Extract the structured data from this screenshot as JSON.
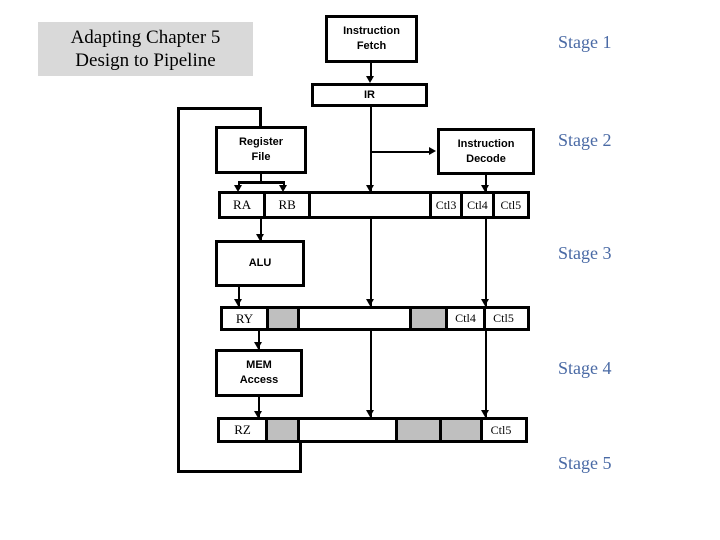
{
  "slide": {
    "title_lines": [
      "Adapting Chapter 5",
      "Design to Pipeline"
    ],
    "background_color": "#ffffff",
    "title_background_color": "#d9d9d9",
    "stage_label_color": "#4a6aa5"
  },
  "stages": [
    {
      "label": "Stage 1"
    },
    {
      "label": "Stage 2"
    },
    {
      "label": "Stage 3"
    },
    {
      "label": "Stage 4"
    },
    {
      "label": "Stage 5"
    }
  ],
  "blocks": {
    "instruction_fetch": {
      "lines": [
        "Instruction",
        "Fetch"
      ]
    },
    "instruction_decode": {
      "lines": [
        "Instruction",
        "Decode"
      ]
    },
    "register_file": {
      "lines": [
        "Register",
        "File"
      ]
    },
    "alu": {
      "lines": [
        "ALU"
      ]
    },
    "mem_access": {
      "lines": [
        "MEM",
        "Access"
      ]
    }
  },
  "registers": {
    "ir": {
      "label": "IR"
    }
  },
  "latches": [
    {
      "name": "stage2-latch",
      "cells": [
        {
          "label": "RA",
          "fill": "white"
        },
        {
          "label": "RB",
          "fill": "white"
        },
        {
          "label": "",
          "fill": "white"
        },
        {
          "label": "Ctl3",
          "fill": "white"
        },
        {
          "label": "Ctl4",
          "fill": "white"
        },
        {
          "label": "Ctl5",
          "fill": "white"
        }
      ]
    },
    {
      "name": "stage3-latch",
      "cells": [
        {
          "label": "RY",
          "fill": "white"
        },
        {
          "label": "",
          "fill": "gray"
        },
        {
          "label": "",
          "fill": "white"
        },
        {
          "label": "",
          "fill": "gray"
        },
        {
          "label": "Ctl4",
          "fill": "white"
        },
        {
          "label": "Ctl5",
          "fill": "white"
        }
      ]
    },
    {
      "name": "stage4-latch",
      "cells": [
        {
          "label": "RZ",
          "fill": "white"
        },
        {
          "label": "",
          "fill": "gray"
        },
        {
          "label": "",
          "fill": "white"
        },
        {
          "label": "",
          "fill": "gray"
        },
        {
          "label": "",
          "fill": "gray"
        },
        {
          "label": "Ctl5",
          "fill": "white"
        }
      ]
    }
  ]
}
